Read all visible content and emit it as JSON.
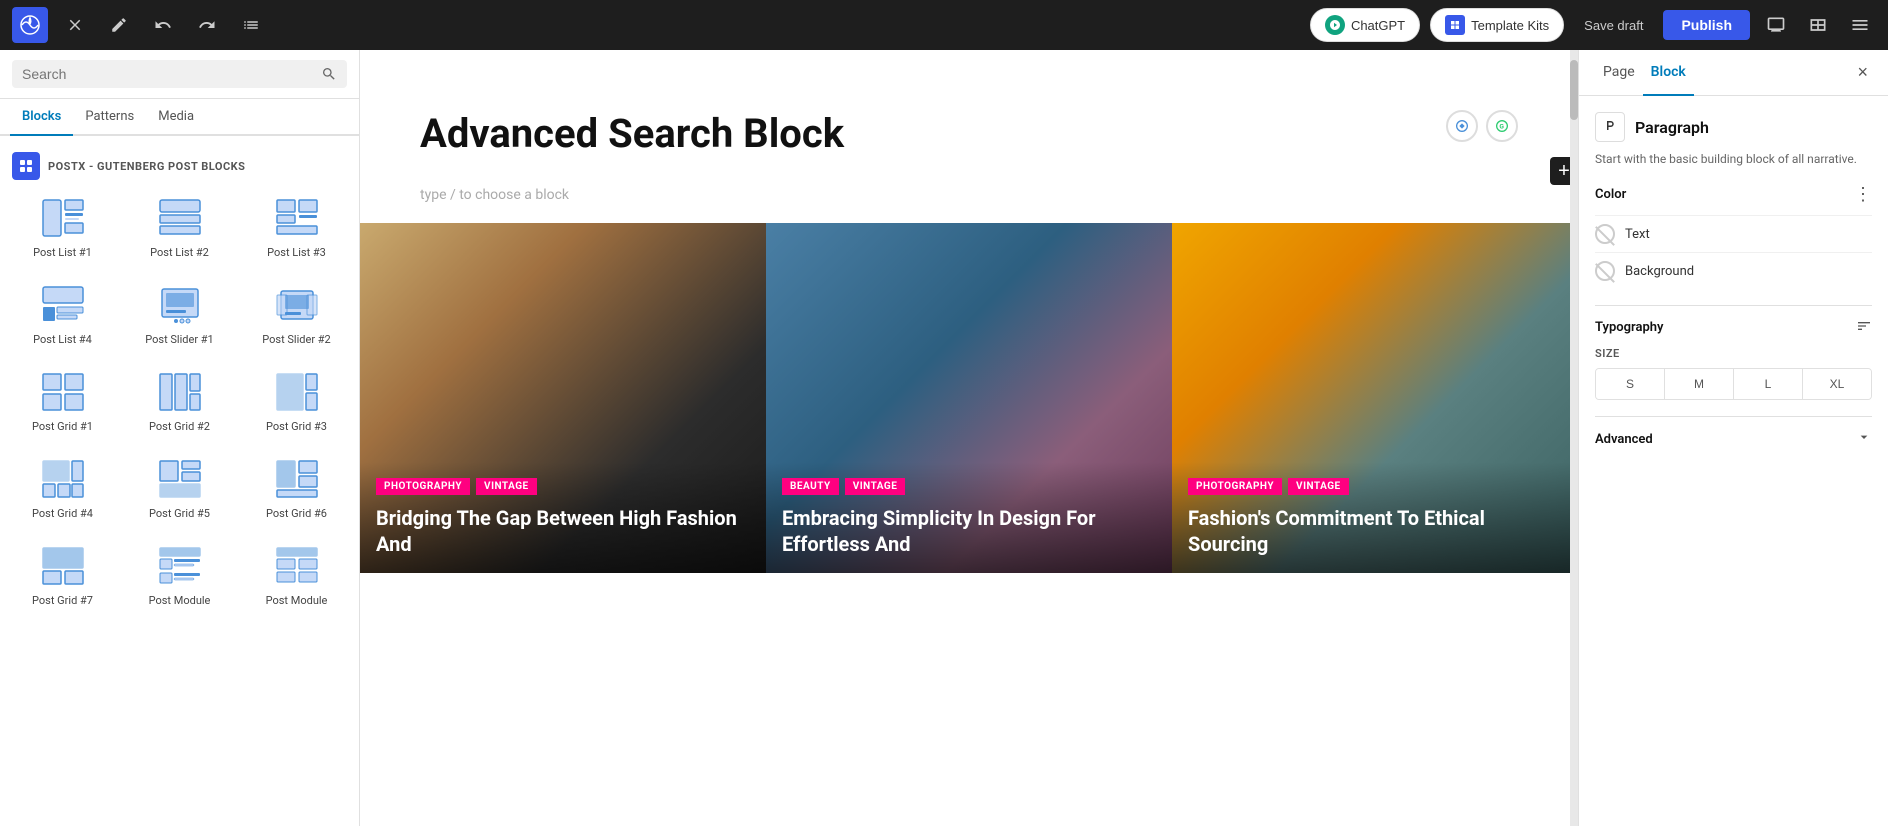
{
  "topbar": {
    "wp_logo_label": "WordPress",
    "close_label": "×",
    "undo_label": "Undo",
    "redo_label": "Redo",
    "list_view_label": "List View",
    "chatgpt_label": "ChatGPT",
    "template_kits_label": "Template Kits",
    "save_draft_label": "Save draft",
    "publish_label": "Publish",
    "view_label": "View",
    "layout_label": "Layout",
    "sidebar_label": "Sidebar"
  },
  "left_sidebar": {
    "search_placeholder": "Search",
    "tabs": [
      {
        "id": "blocks",
        "label": "Blocks",
        "active": true
      },
      {
        "id": "patterns",
        "label": "Patterns",
        "active": false
      },
      {
        "id": "media",
        "label": "Media",
        "active": false
      }
    ],
    "section_label": "POSTX - GUTENBERG POST BLOCKS",
    "blocks": [
      {
        "id": "post-list-1",
        "label": "Post List #1"
      },
      {
        "id": "post-list-2",
        "label": "Post List #2"
      },
      {
        "id": "post-list-3",
        "label": "Post List #3"
      },
      {
        "id": "post-list-4",
        "label": "Post List #4"
      },
      {
        "id": "post-slider-1",
        "label": "Post Slider #1"
      },
      {
        "id": "post-slider-2",
        "label": "Post Slider #2"
      },
      {
        "id": "post-grid-1",
        "label": "Post Grid #1"
      },
      {
        "id": "post-grid-2",
        "label": "Post Grid #2"
      },
      {
        "id": "post-grid-3",
        "label": "Post Grid #3"
      },
      {
        "id": "post-grid-4",
        "label": "Post Grid #4"
      },
      {
        "id": "post-grid-5",
        "label": "Post Grid #5"
      },
      {
        "id": "post-grid-6",
        "label": "Post Grid #6"
      },
      {
        "id": "post-grid-7",
        "label": "Post Grid #7"
      },
      {
        "id": "post-module-1",
        "label": "Post Module"
      },
      {
        "id": "post-module-2",
        "label": "Post Module"
      }
    ]
  },
  "editor": {
    "page_title": "Advanced Search Block",
    "block_placeholder": "type / to choose a block",
    "cards": [
      {
        "id": "card-1",
        "tags": [
          "PHOTOGRAPHY",
          "VINTAGE"
        ],
        "title": "Bridging The Gap Between High Fashion And"
      },
      {
        "id": "card-2",
        "tags": [
          "BEAUTY",
          "VINTAGE"
        ],
        "title": "Embracing Simplicity In Design For Effortless And"
      },
      {
        "id": "card-3",
        "tags": [
          "PHOTOGRAPHY",
          "VINTAGE"
        ],
        "title": "Fashion's Commitment To Ethical Sourcing"
      }
    ]
  },
  "right_sidebar": {
    "tabs": [
      {
        "id": "page",
        "label": "Page",
        "active": false
      },
      {
        "id": "block",
        "label": "Block",
        "active": true
      }
    ],
    "close_label": "×",
    "panel": {
      "icon_type": "paragraph",
      "title": "Paragraph",
      "description": "Start with the basic building block of all narrative."
    },
    "color": {
      "title": "Color",
      "menu_label": "⋮",
      "text_label": "Text",
      "background_label": "Background"
    },
    "typography": {
      "title": "Typography",
      "size_label": "SIZE",
      "sizes": [
        "S",
        "M",
        "L",
        "XL"
      ]
    },
    "advanced": {
      "title": "Advanced"
    }
  }
}
